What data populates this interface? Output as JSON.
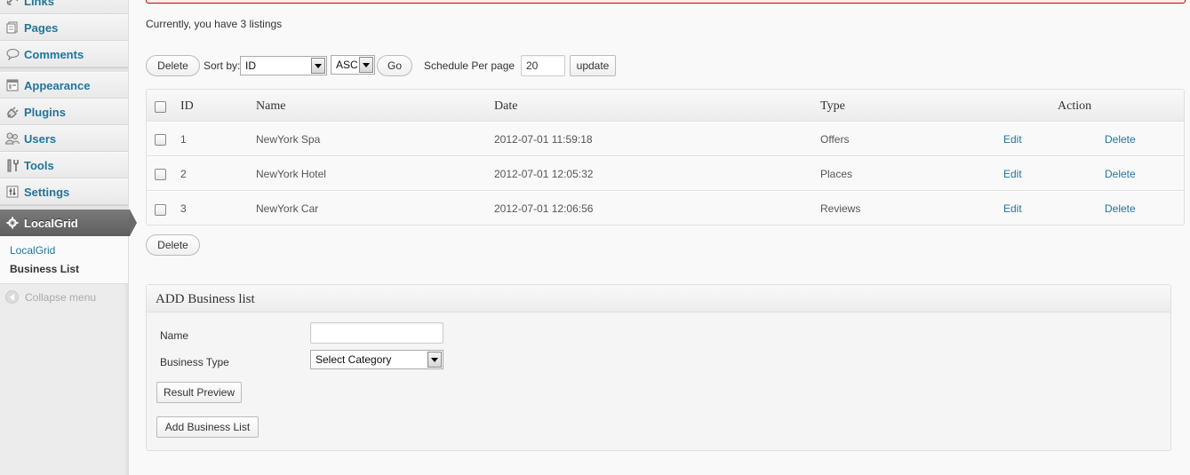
{
  "sidebar": {
    "menu": [
      {
        "label": "Links",
        "icon": "links-icon"
      },
      {
        "label": "Pages",
        "icon": "pages-icon"
      },
      {
        "label": "Comments",
        "icon": "comments-icon"
      },
      {
        "label": "Appearance",
        "icon": "appearance-icon"
      },
      {
        "label": "Plugins",
        "icon": "plugins-icon"
      },
      {
        "label": "Users",
        "icon": "users-icon"
      },
      {
        "label": "Tools",
        "icon": "tools-icon"
      },
      {
        "label": "Settings",
        "icon": "settings-icon"
      }
    ],
    "current": {
      "label": "LocalGrid",
      "icon": "gear-icon"
    },
    "submenu": [
      "LocalGrid",
      "Business List"
    ],
    "collapse_label": "Collapse menu"
  },
  "main": {
    "status": "Currently, you have 3 listings",
    "toolbar": {
      "delete_label": "Delete",
      "sort_by_label": "Sort by:",
      "sort_field": "ID",
      "sort_order": "ASC",
      "go_label": "Go",
      "per_page_label": "Schedule Per page",
      "per_page_value": "20",
      "update_label": "update"
    },
    "table": {
      "headers": [
        "ID",
        "Name",
        "Date",
        "Type",
        "Action"
      ],
      "rows": [
        {
          "id": "1",
          "name": "NewYork Spa",
          "date": "2012-07-01 11:59:18",
          "type": "Offers",
          "edit": "Edit",
          "delete": "Delete"
        },
        {
          "id": "2",
          "name": "NewYork Hotel",
          "date": "2012-07-01 12:05:32",
          "type": "Places",
          "edit": "Edit",
          "delete": "Delete"
        },
        {
          "id": "3",
          "name": "NewYork Car",
          "date": "2012-07-01 12:06:56",
          "type": "Reviews",
          "edit": "Edit",
          "delete": "Delete"
        }
      ]
    },
    "bottom_delete_label": "Delete",
    "add_box": {
      "title": "ADD Business list",
      "name_label": "Name",
      "name_value": "",
      "type_label": "Business Type",
      "type_value": "Select Category",
      "preview_label": "Result Preview",
      "add_label": "Add Business List"
    }
  },
  "colors": {
    "link": "#21759b",
    "current_menu": "#6a6a6a",
    "error_border": "#cc0000"
  }
}
